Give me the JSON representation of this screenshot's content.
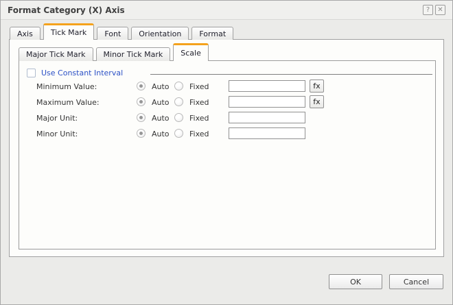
{
  "window": {
    "title": "Format Category (X) Axis",
    "help_glyph": "?",
    "close_glyph": "✕"
  },
  "tabs_level1": {
    "items": [
      "Axis",
      "Tick Mark",
      "Font",
      "Orientation",
      "Format"
    ],
    "active": "Tick Mark"
  },
  "tabs_level2": {
    "items": [
      "Major Tick Mark",
      "Minor Tick Mark",
      "Scale"
    ],
    "active": "Scale"
  },
  "scale_panel": {
    "constant_interval": {
      "label": "Use Constant Interval",
      "checked": false
    },
    "rows": [
      {
        "label": "Minimum Value:",
        "auto_label": "Auto",
        "fixed_label": "Fixed",
        "selected": "Auto",
        "value": "",
        "fx_label": "fx"
      },
      {
        "label": "Maximum Value:",
        "auto_label": "Auto",
        "fixed_label": "Fixed",
        "selected": "Auto",
        "value": "",
        "fx_label": "fx"
      },
      {
        "label": "Major Unit:",
        "auto_label": "Auto",
        "fixed_label": "Fixed",
        "selected": "Auto",
        "value": ""
      },
      {
        "label": "Minor Unit:",
        "auto_label": "Auto",
        "fixed_label": "Fixed",
        "selected": "Auto",
        "value": ""
      }
    ]
  },
  "footer": {
    "ok_label": "OK",
    "cancel_label": "Cancel"
  },
  "colors": {
    "accent_orange": "#F5A21C",
    "link_blue": "#2B50C6"
  }
}
